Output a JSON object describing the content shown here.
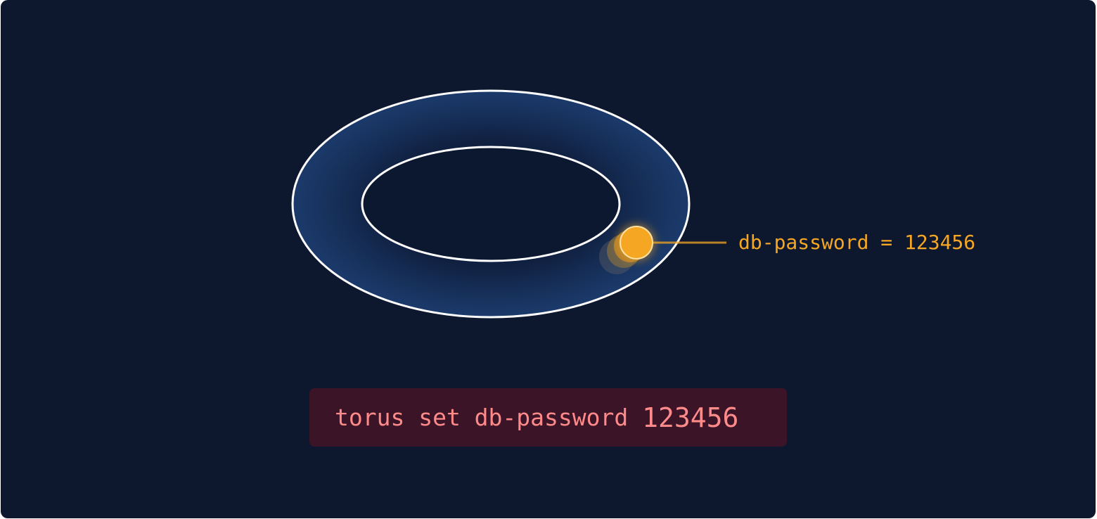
{
  "colors": {
    "background": "#0d182e",
    "ring_fill": "#17315c",
    "ring_outline": "#ffffff",
    "accent": "#f5a623",
    "command_bg": "#3b1428",
    "command_text": "#ff8a8a"
  },
  "ring": {
    "marker_label": "db-password = 123456"
  },
  "command": {
    "text": "torus set db-password",
    "value": "123456"
  }
}
